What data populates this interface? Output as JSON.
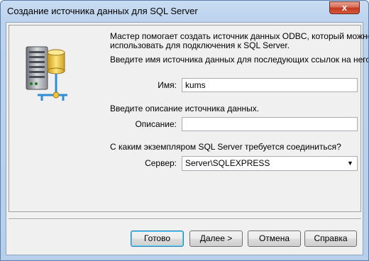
{
  "window": {
    "title": "Создание источника данных для SQL Server",
    "close_glyph": "x"
  },
  "intro": {
    "line1": "Мастер помогает создать источник данных ODBC, который можно",
    "line2": "использовать для подключения к SQL Server.",
    "line3": "Введите имя источника данных для последующих ссылок на него."
  },
  "name_field": {
    "label": "Имя:",
    "value": "kums"
  },
  "description": {
    "prompt": "Введите описание источника данных.",
    "label": "Описание:",
    "value": ""
  },
  "server": {
    "prompt": "С каким экземпляром SQL Server требуется соединиться?",
    "label": "Сервер:",
    "value": "Server\\SQLEXPRESS"
  },
  "buttons": {
    "finish": "Готово",
    "next": "Далее >",
    "cancel": "Отмена",
    "help": "Справка"
  }
}
